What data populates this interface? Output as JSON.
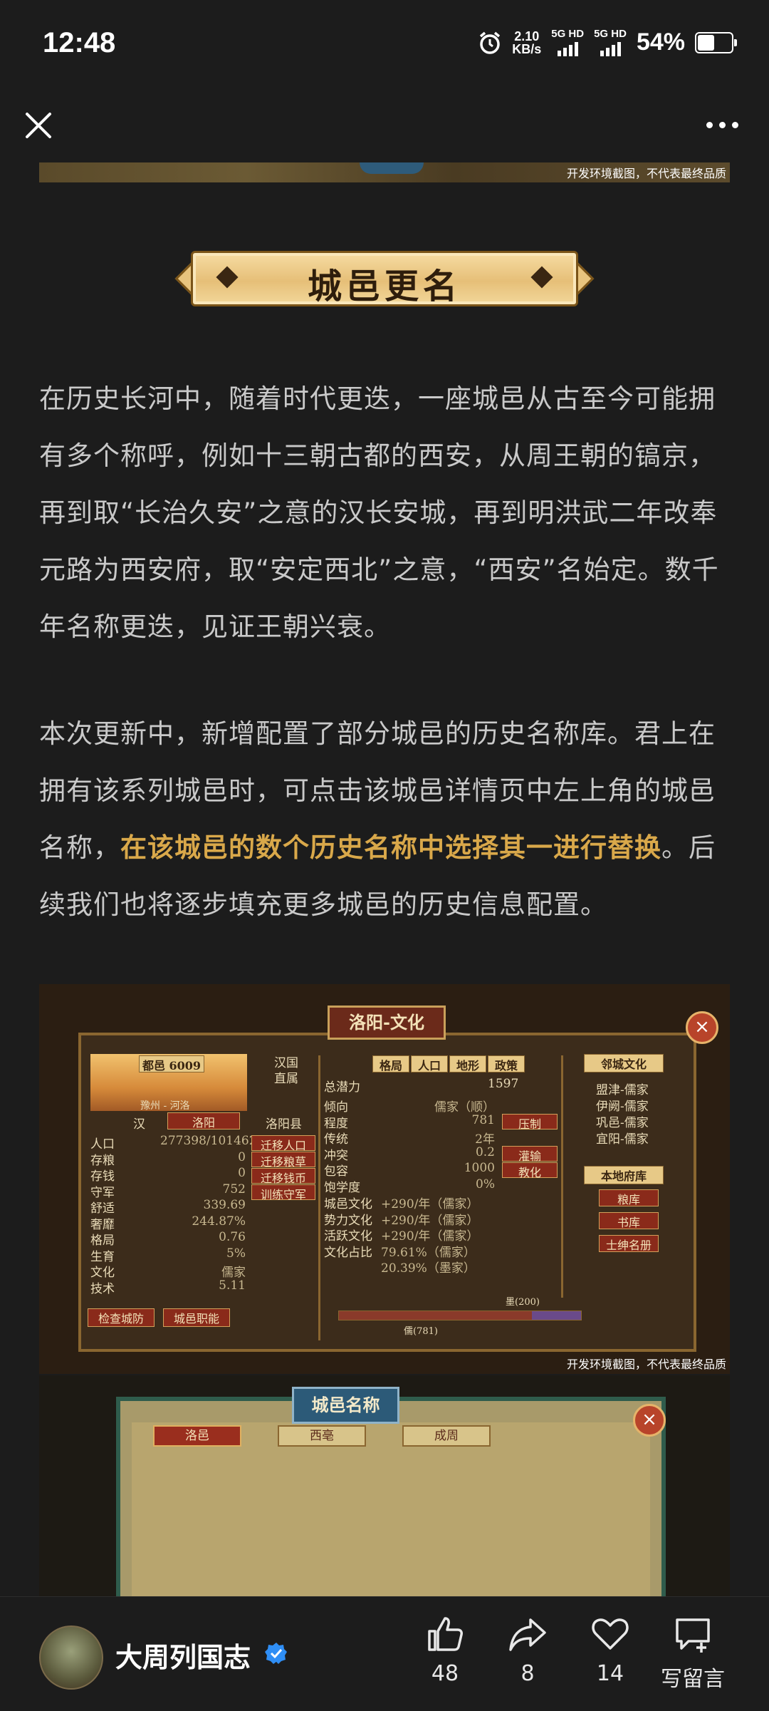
{
  "status_bar": {
    "time": "12:48",
    "net_speed_value": "2.10",
    "net_speed_unit": "KB/s",
    "sim1": "5G HD",
    "sim2": "5G HD",
    "battery_percent": "54%",
    "battery_level": 0.54,
    "icons": [
      "alarm-icon",
      "signal-icon",
      "battery-icon"
    ]
  },
  "top_bar": {
    "close_icon": "close-icon",
    "more_icon": "more-icon"
  },
  "caption_text": "开发环境截图，不代表最终品质",
  "section_banner": "城邑更名",
  "paragraph1": "在历史长河中，随着时代更迭，一座城邑从古至今可能拥有多个称呼，例如十三朝古都的西安，从周王朝的镐京，再到取“长治久安”之意的汉长安城，再到明洪武二年改奉元路为西安府，取“安定西北”之意，“西安”名始定。数千年名称更迭，见证王朝兴衰。",
  "paragraph2": {
    "part1": "本次更新中，新增配置了部分城邑的历史名称库。君上在拥有该系列城邑时，可点击该城邑详情页中左上角的城邑名称，",
    "highlight": "在该城邑的数个历史名称中选择其一进行替换",
    "part2": "。后续我们也将逐步填充更多城邑的历史信息配置。"
  },
  "screenshot1": {
    "title": "洛阳-文化",
    "city_rank": "都邑",
    "city_id": "6009",
    "region": "豫州 - 河洛",
    "country": "汉",
    "city_name": "洛阳",
    "belong": [
      "汉国",
      "直属"
    ],
    "county": "洛阳县",
    "left_stats": [
      {
        "label": "人口",
        "value": "277398/1014620"
      },
      {
        "label": "存粮",
        "value": "0"
      },
      {
        "label": "存钱",
        "value": "0"
      },
      {
        "label": "守军",
        "value": "752"
      },
      {
        "label": "舒适",
        "value": "339.69"
      },
      {
        "label": "奢靡",
        "value": "244.87%"
      },
      {
        "label": "格局",
        "value": "0.76"
      },
      {
        "label": "生育",
        "value": "5%"
      },
      {
        "label": "文化",
        "value": "儒家"
      },
      {
        "label": "技术",
        "value": "5.11"
      }
    ],
    "side_buttons": [
      "迁移人口",
      "迁移粮草",
      "迁移钱币",
      "训练守军"
    ],
    "bottom_buttons": [
      "检查城防",
      "城邑职能"
    ],
    "tabs": [
      "格局",
      "人口",
      "地形",
      "政策"
    ],
    "potential": {
      "label": "总潜力",
      "value": "1597"
    },
    "mid_stats": [
      {
        "label": "倾向",
        "value": "儒家（顺）"
      },
      {
        "label": "程度",
        "value": "781"
      },
      {
        "label": "传统",
        "value": "2年"
      },
      {
        "label": "冲突",
        "value": "0.2"
      },
      {
        "label": "包容",
        "value": "1000"
      },
      {
        "label": "饱学度",
        "value": "0%"
      }
    ],
    "mid_buttons": [
      "压制",
      "灌输",
      "教化"
    ],
    "culture_rows": [
      {
        "label": "城邑文化",
        "value": "+290/年（儒家）"
      },
      {
        "label": "势力文化",
        "value": "+290/年（儒家）"
      },
      {
        "label": "活跃文化",
        "value": "+290/年（儒家）"
      },
      {
        "label": "文化占比",
        "value": "79.61%（儒家）"
      },
      {
        "label": "",
        "value": "20.39%（墨家）"
      }
    ],
    "bar_labels": [
      "墨(200)",
      "儒(781)"
    ],
    "neighbor_title": "邻城文化",
    "neighbors": [
      "盟津-儒家",
      "伊阙-儒家",
      "巩邑-儒家",
      "宜阳-儒家"
    ],
    "local_title": "本地府库",
    "local_buttons": [
      "粮库",
      "书库",
      "士绅名册"
    ]
  },
  "screenshot2": {
    "title": "城邑名称",
    "options": [
      "洛邑",
      "西亳",
      "成周"
    ]
  },
  "bottom_bar": {
    "account_name": "大周列国志",
    "likes": "48",
    "shares": "8",
    "favorites": "14",
    "comment_label": "写留言",
    "icons": [
      "thumbs-up-icon",
      "share-icon",
      "heart-icon",
      "comment-icon",
      "verified-icon"
    ]
  }
}
